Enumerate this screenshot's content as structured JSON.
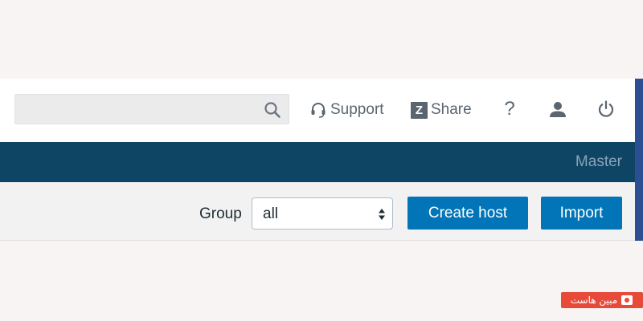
{
  "topbar": {
    "search": {
      "value": "",
      "placeholder": ""
    },
    "support_label": "Support",
    "share_label": "Share",
    "share_logo_letter": "Z",
    "help_label": "?"
  },
  "server_bar": {
    "server_name": "Master"
  },
  "filter_bar": {
    "group_label": "Group",
    "group_selected": "all",
    "create_host_label": "Create host",
    "import_label": "Import"
  },
  "watermark": {
    "text": "مبین هاست"
  },
  "colors": {
    "header_navy": "#0e4565",
    "button_blue": "#0275b8",
    "icon_gray": "#5a6570",
    "right_edge": "#2c4f93",
    "watermark_red": "#e84a3a"
  },
  "icons": [
    "search-icon",
    "headset-icon",
    "z-logo-icon",
    "help-icon",
    "user-icon",
    "power-icon",
    "select-arrows-icon"
  ]
}
